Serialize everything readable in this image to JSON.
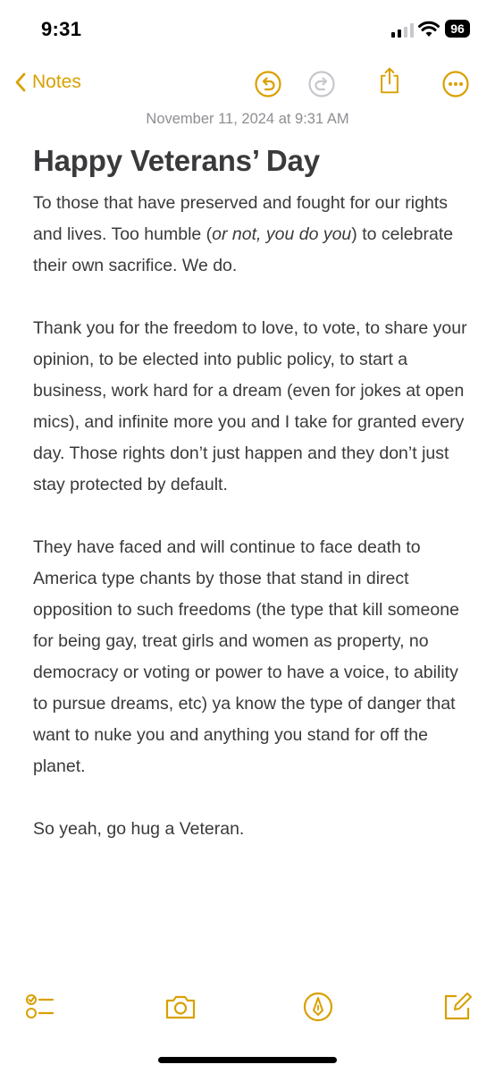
{
  "status_bar": {
    "time": "9:31",
    "battery_level": "96",
    "icons": [
      "signal-icon",
      "wifi-icon",
      "battery-icon"
    ]
  },
  "nav": {
    "back_label": "Notes",
    "icons": [
      "chevron-left-icon",
      "undo-icon",
      "redo-icon",
      "share-icon",
      "more-icon"
    ]
  },
  "note": {
    "date_line": "November 11, 2024 at 9:31 AM",
    "title": "Happy Veterans’ Day",
    "p1_a": "To those that have preserved and fought for our rights and lives. Too humble (",
    "p1_em": "or not, you do you",
    "p1_b": ") to celebrate their own sacrifice. We do.",
    "p2": "Thank you for the freedom to love, to vote, to share your opinion, to be elected into public policy, to start a business, work hard for a dream (even for jokes at open mics), and infinite more you and I take for granted every day. Those rights don’t just happen and they don’t just stay protected by default.",
    "p3": "They have faced and will continue to face death to America type chants by those that stand in direct opposition to such freedoms (the type that kill someone for being gay, treat girls and women as property, no democracy or voting or power to have a voice, to ability to pursue dreams, etc) ya know the type of danger that want to nuke you and anything you stand for off the planet.",
    "p4": "So yeah, go hug a Veteran."
  },
  "toolbar": {
    "icons": [
      "checklist-icon",
      "camera-icon",
      "markup-pen-icon",
      "compose-icon"
    ]
  },
  "colors": {
    "accent": "#d9a000",
    "text": "#3a3a3c",
    "secondary_text": "#8e8e93",
    "background": "#ffffff"
  }
}
